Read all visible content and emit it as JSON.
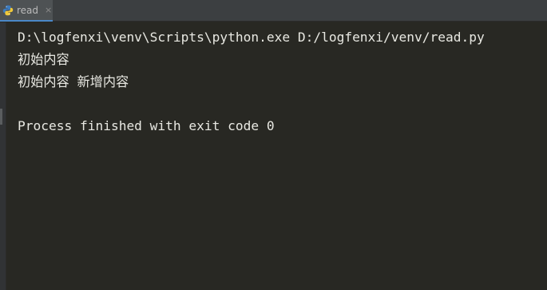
{
  "tab": {
    "label": "read",
    "close_glyph": "×",
    "icon": "python-icon"
  },
  "console": {
    "lines": [
      "D:\\logfenxi\\venv\\Scripts\\python.exe D:/logfenxi/venv/read.py",
      "初始内容",
      "初始内容 新增内容",
      "",
      "Process finished with exit code 0"
    ]
  },
  "colors": {
    "background": "#282823",
    "text": "#e8e8e2",
    "tab_bar": "#3c3f41",
    "tab_accent": "#4a88c7"
  }
}
